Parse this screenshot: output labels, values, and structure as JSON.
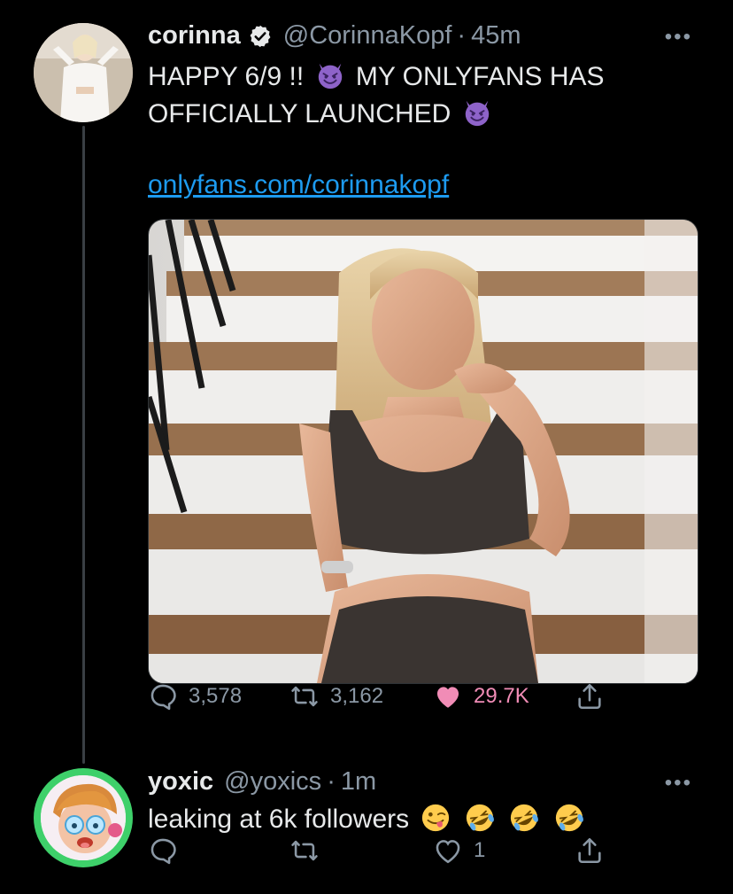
{
  "thread": [
    {
      "author": {
        "name": "corinna",
        "handle": "@CorinnaKopf",
        "verified": true,
        "time": "45m"
      },
      "text_parts": [
        "HAPPY 6/9 !! ",
        " MY ONLYFANS HAS OFFICIALLY LAUNCHED "
      ],
      "emoji": [
        "smiling-imp-emoji",
        "smiling-imp-emoji"
      ],
      "link": "onlyfans.com/corinnakopf",
      "media": {
        "description_icon": "photo"
      },
      "stats": {
        "replies": "3,578",
        "retweets": "3,162",
        "likes": "29.7K",
        "liked": true
      }
    },
    {
      "author": {
        "name": "yoxic",
        "handle": "@yoxics",
        "verified": false,
        "time": "1m"
      },
      "text": "leaking at 6k followers",
      "emoji": [
        "winking-tongue-emoji",
        "rofl-emoji",
        "rofl-emoji",
        "rofl-emoji"
      ],
      "stats": {
        "replies": "",
        "retweets": "",
        "likes": "1",
        "liked": false
      }
    }
  ],
  "more_menu": "•••",
  "separator": "·",
  "colors": {
    "background": "#000000",
    "text": "#e7e9ea",
    "muted": "#8b98a5",
    "link": "#1d9bf0",
    "like": "#f91880"
  }
}
